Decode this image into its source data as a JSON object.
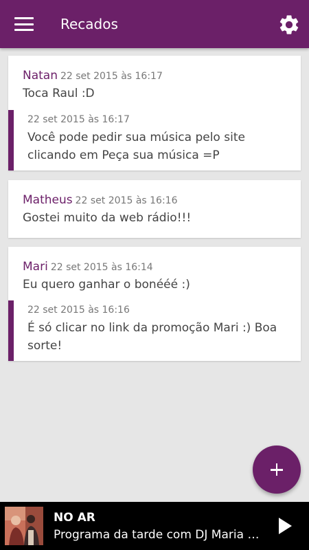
{
  "appbar": {
    "title": "Recados",
    "menu_icon": "hamburger-menu-icon",
    "settings_icon": "gear-icon",
    "color": "#6b2068"
  },
  "messages": [
    {
      "author": "Natan",
      "date": "22 set 2015 às 16:17",
      "text": "Toca Raul :D",
      "reply": {
        "date": "22 set 2015 às 16:17",
        "text": "Você pode pedir sua música pelo site clicando em Peça sua música =P"
      }
    },
    {
      "author": "Matheus",
      "date": "22 set 2015 às 16:16",
      "text": "Gostei muito da web rádio!!!"
    },
    {
      "author": "Mari",
      "date": "22 set 2015 às 16:14",
      "text": "Eu quero ganhar o bonééé :)",
      "reply": {
        "date": "22 set 2015 às 16:16",
        "text": "É só clicar no link da promoção Mari :) Boa sorte!"
      }
    }
  ],
  "fab": {
    "icon": "plus-icon"
  },
  "player": {
    "status": "NO AR",
    "program": "Programa da tarde com DJ Maria Rá...",
    "play_icon": "play-icon"
  }
}
